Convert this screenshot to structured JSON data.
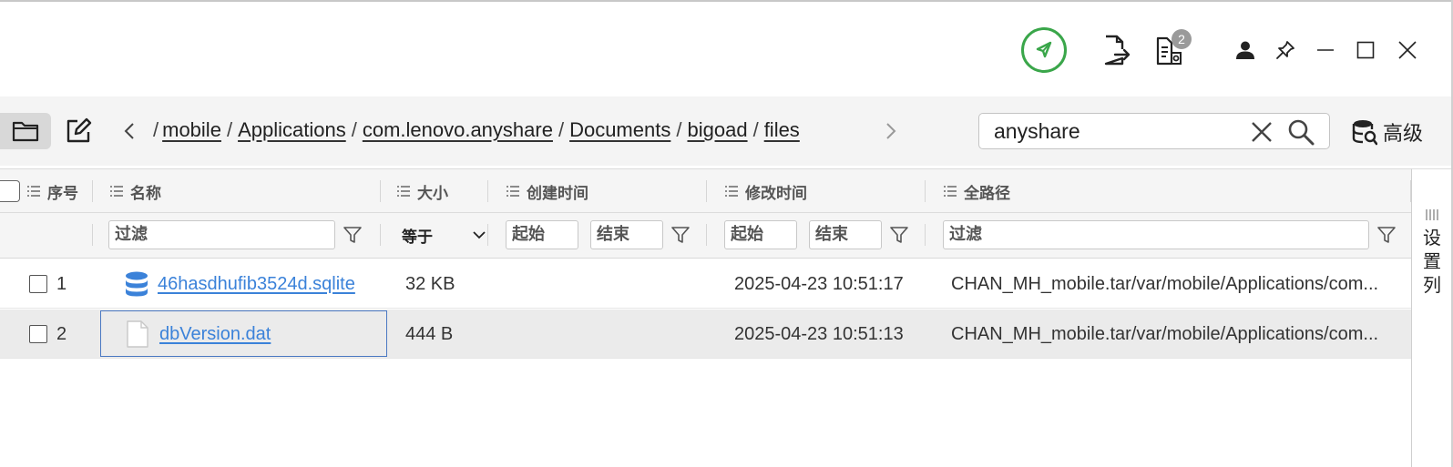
{
  "titlebar": {
    "badge_count": "2",
    "accent_color": "#3aa64a",
    "icons": [
      "rocket-icon",
      "export-document-icon",
      "document-list-icon",
      "user-icon",
      "pin-icon",
      "minimize-icon",
      "maximize-icon",
      "close-icon"
    ]
  },
  "toolbar": {
    "breadcrumb_cut": "/",
    "breadcrumb": [
      "mobile",
      "Applications",
      "com.lenovo.anyshare",
      "Documents",
      "bigoad",
      "files"
    ],
    "separator": "/",
    "search": {
      "value": "anyshare",
      "placeholder": ""
    },
    "advanced_label": "高级"
  },
  "table": {
    "columns": {
      "seq": "序号",
      "name": "名称",
      "size": "大小",
      "created": "创建时间",
      "modified": "修改时间",
      "path": "全路径"
    },
    "filters": {
      "name_placeholder": "过滤",
      "size_operator": "等于",
      "created_start": "起始",
      "created_end": "结束",
      "modified_start": "起始",
      "modified_end": "结束",
      "path_placeholder": "过滤"
    },
    "rows": [
      {
        "seq": "1",
        "name": "46hasdhufib3524d.sqlite",
        "icon": "database-icon",
        "size": "32 KB",
        "created": "",
        "modified": "2025-04-23 10:51:17",
        "path": "CHAN_MH_mobile.tar/var/mobile/Applications/com..."
      },
      {
        "seq": "2",
        "name": "dbVersion.dat",
        "icon": "file-icon",
        "size": "444 B",
        "created": "",
        "modified": "2025-04-23 10:51:13",
        "path": "CHAN_MH_mobile.tar/var/mobile/Applications/com..."
      }
    ],
    "set_columns_label": [
      "设",
      "置",
      "列"
    ]
  }
}
